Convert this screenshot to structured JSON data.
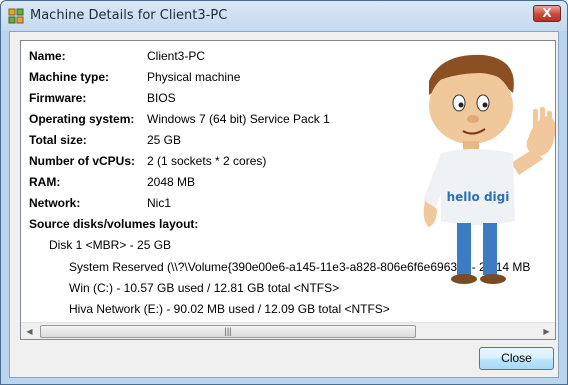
{
  "window": {
    "title": "Machine Details for Client3-PC",
    "close_glyph": "X"
  },
  "details": [
    {
      "label": "Name:",
      "value": "Client3-PC"
    },
    {
      "label": "Machine type:",
      "value": "Physical machine"
    },
    {
      "label": "Firmware:",
      "value": "BIOS"
    },
    {
      "label": "Operating system:",
      "value": "Windows 7  (64 bit) Service Pack 1"
    },
    {
      "label": "Total size:",
      "value": "25 GB"
    },
    {
      "label": "Number of vCPUs:",
      "value": "2 (1 sockets * 2 cores)"
    },
    {
      "label": "RAM:",
      "value": "2048 MB"
    },
    {
      "label": "Network:",
      "value": "Nic1"
    }
  ],
  "layout_heading": "Source disks/volumes layout:",
  "disk": "Disk 1 <MBR> - 25 GB",
  "volumes": [
    "System Reserved (\\\\?\\Volume{390e00e6-a145-11e3-a828-806e6f6e6963}\\) - 28.14 MB",
    "Win (C:) - 10.57 GB used / 12.81 GB total <NTFS>",
    "Hiva Network (E:) - 90.02 MB used / 12.09 GB total <NTFS>"
  ],
  "mascot": {
    "shirt_text": "hello digi"
  },
  "scrollbar": {
    "left_glyph": "◀",
    "right_glyph": "▶",
    "grip_glyph": "|||"
  },
  "buttons": {
    "close_label": "Close"
  },
  "icons": {
    "app": "app-icon",
    "window_close": "close-icon"
  }
}
